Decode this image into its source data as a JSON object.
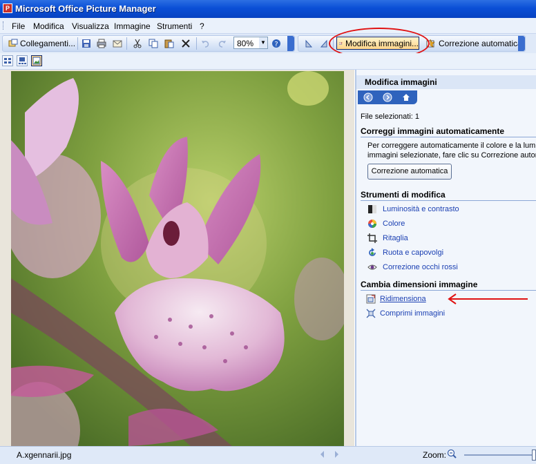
{
  "window": {
    "title": "Microsoft Office Picture Manager"
  },
  "menu": [
    "File",
    "Modifica",
    "Visualizza",
    "Immagine",
    "Strumenti",
    "?"
  ],
  "toolbar": {
    "shortcuts_label": "Collegamenti...",
    "zoom_value": "80%",
    "edit_label": "Modifica immagini...",
    "autocorrect_label": "Correzione automatica"
  },
  "pane": {
    "title": "Modifica immagini",
    "selected": "File selezionati: 1",
    "section_auto": "Correggi immagini automaticamente",
    "auto_desc_1": "Per correggere automaticamente il colore e la lumino",
    "auto_desc_2": "immagini selezionate, fare clic su Correzione automat",
    "auto_button": "Correzione automatica",
    "section_tools": "Strumenti di modifica",
    "tools": [
      "Luminosità e contrasto",
      "Colore",
      "Ritaglia",
      "Ruota e capovolgi",
      "Correzione occhi rossi"
    ],
    "section_resize": "Cambia dimensioni immagine",
    "resize": [
      "Ridimensiona",
      "Comprimi immagini"
    ]
  },
  "status": {
    "filename": "A.xgennarii.jpg",
    "zoom_label": "Zoom:"
  },
  "colors": {
    "titlebar": "#0a4fd6",
    "annotation_red": "#e01010",
    "link_blue": "#1a3fb2"
  }
}
